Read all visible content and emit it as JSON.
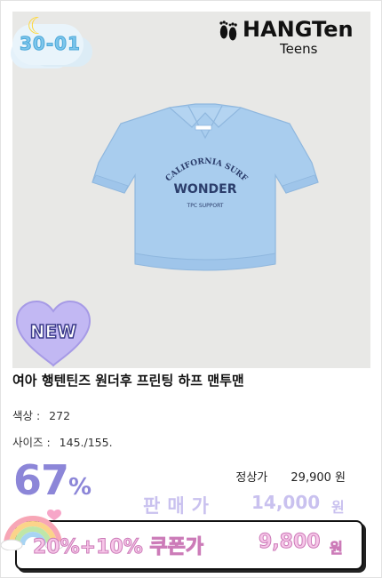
{
  "product": {
    "code": "30-01",
    "brand_name": "HANGTen",
    "brand_sub": "Teens",
    "badge": "NEW",
    "title": "여아 행텐틴즈 원더후 프린팅 하프 맨투맨",
    "print": {
      "arc": "CALIFORNIA SURF",
      "main": "WONDER",
      "small": "TPC SUPPORT"
    },
    "shirt_color": "#a9cdee"
  },
  "specs": {
    "color_label": "색상 :",
    "color_value": "272",
    "size_label": "사이즈 :",
    "size_value": "145./155."
  },
  "pricing": {
    "discount_num": "67",
    "discount_unit": "%",
    "regular_label": "정상가",
    "regular_price": "29,900 원",
    "sale_label": "판매가",
    "sale_price": "14,000",
    "sale_unit": "원",
    "coupon_label": "20%+10% 쿠폰가",
    "coupon_price": "9,800",
    "coupon_unit": "원"
  },
  "colors": {
    "accent_purple": "#8c86d8",
    "coupon_pink": "#f6c6e8",
    "badge_blue": "#7ec6ec"
  }
}
